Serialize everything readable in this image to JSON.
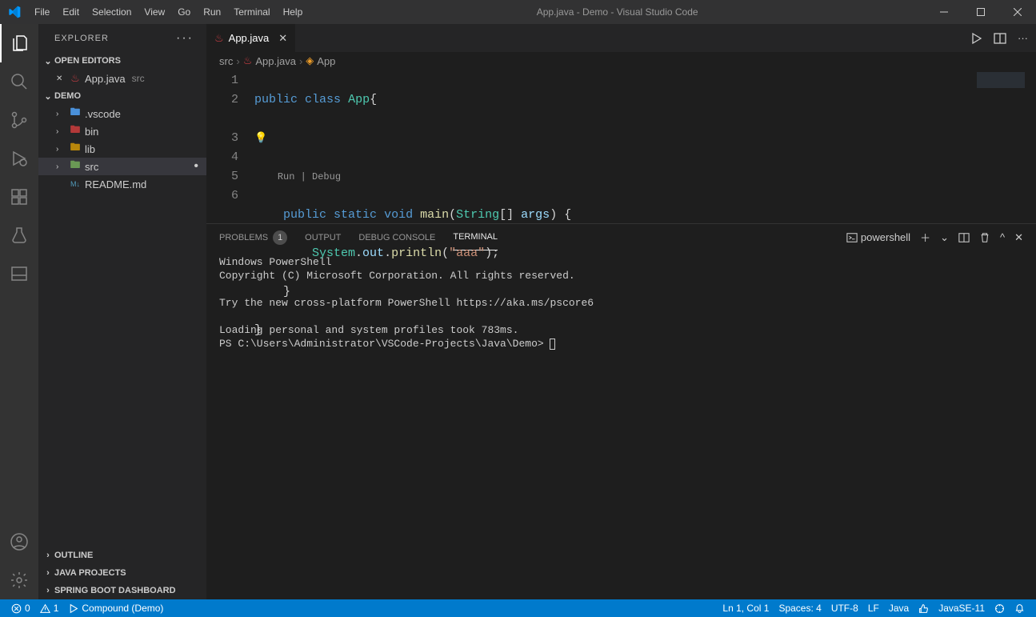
{
  "window_title": "App.java - Demo - Visual Studio Code",
  "menu": [
    "File",
    "Edit",
    "Selection",
    "View",
    "Go",
    "Run",
    "Terminal",
    "Help"
  ],
  "sidebar": {
    "title": "EXPLORER",
    "open_editors_label": "OPEN EDITORS",
    "open_editors": [
      {
        "name": "App.java",
        "dir": "src"
      }
    ],
    "workspace_label": "DEMO",
    "tree": [
      {
        "label": ".vscode",
        "kind": "folder"
      },
      {
        "label": "bin",
        "kind": "folder"
      },
      {
        "label": "lib",
        "kind": "folder"
      },
      {
        "label": "src",
        "kind": "folder",
        "active": true,
        "modified": true
      },
      {
        "label": "README.md",
        "kind": "file"
      }
    ],
    "collapsed": [
      "OUTLINE",
      "JAVA PROJECTS",
      "SPRING BOOT DASHBOARD"
    ]
  },
  "tab": {
    "name": "App.java"
  },
  "breadcrumbs": {
    "a": "src",
    "b": "App.java",
    "c": "App"
  },
  "codelens": "Run | Debug",
  "code_lines": {
    "l1": {
      "n": "1"
    },
    "l2": {
      "n": "2"
    },
    "l3": {
      "n": "3"
    },
    "l4": {
      "n": "4"
    },
    "l5": {
      "n": "5"
    },
    "l6": {
      "n": "6"
    }
  },
  "code_tokens": {
    "public": "public",
    "class": "class",
    "App": "App",
    "static": "static",
    "void": "void",
    "main": "main",
    "String": "String",
    "args": "args",
    "System": "System",
    "out": "out",
    "println": "println",
    "aaa": "\"aaa\""
  },
  "panel": {
    "tabs": {
      "problems": "PROBLEMS",
      "problems_badge": "1",
      "output": "OUTPUT",
      "debug": "DEBUG CONSOLE",
      "terminal": "TERMINAL"
    },
    "shell_label": "powershell",
    "terminal_text": "Windows PowerShell\nCopyright (C) Microsoft Corporation. All rights reserved.\n\nTry the new cross-platform PowerShell https://aka.ms/pscore6\n\nLoading personal and system profiles took 783ms.\nPS C:\\Users\\Administrator\\VSCode-Projects\\Java\\Demo> "
  },
  "status": {
    "errors": "0",
    "warnings": "1",
    "debug_config": "Compound (Demo)",
    "cursor": "Ln 1, Col 1",
    "spaces": "Spaces: 4",
    "encoding": "UTF-8",
    "eol": "LF",
    "lang": "Java",
    "jdk": "JavaSE-11"
  }
}
